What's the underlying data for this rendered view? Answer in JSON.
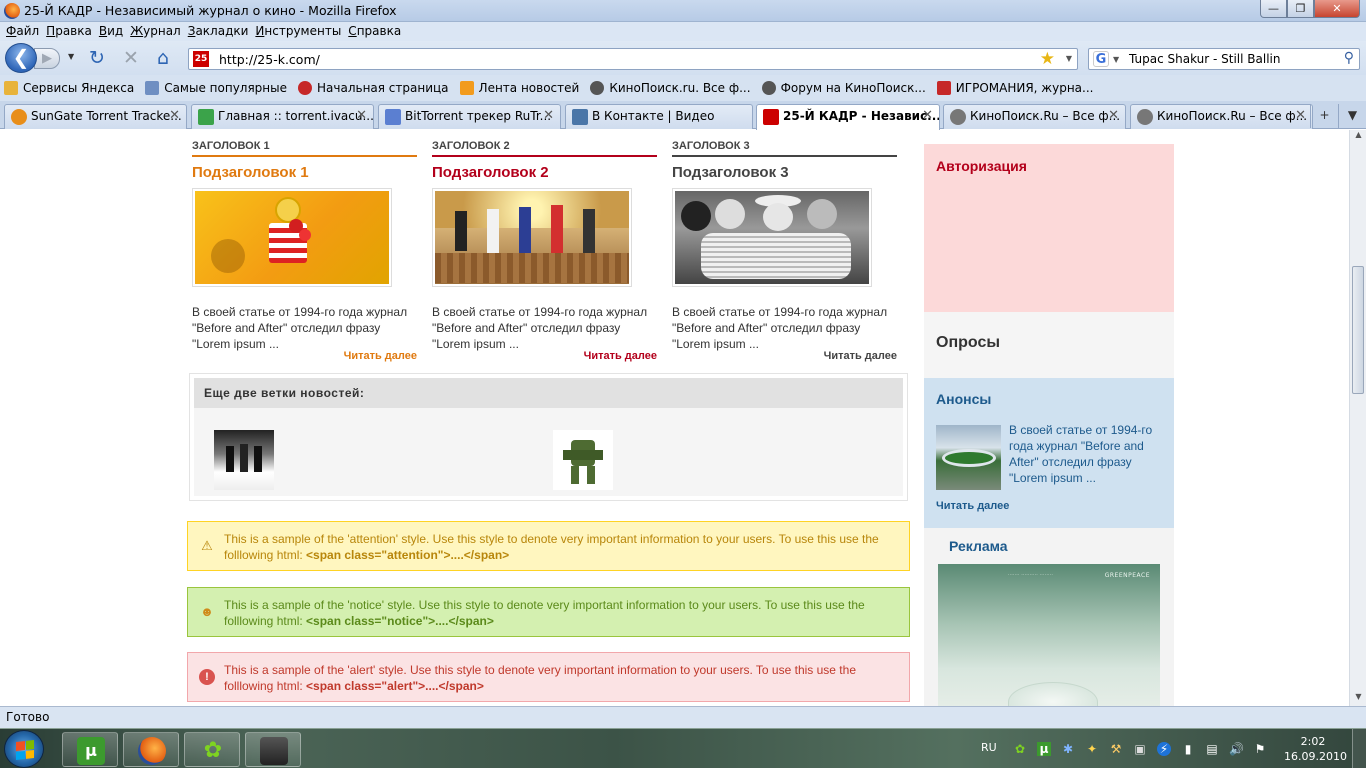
{
  "window": {
    "title": "25-Й КАДР - Независимый журнал о кино - Mozilla Firefox"
  },
  "menu": [
    "Файл",
    "Правка",
    "Вид",
    "Журнал",
    "Закладки",
    "Инструменты",
    "Справка"
  ],
  "nav": {
    "url": "http://25-k.com/",
    "site_favicon": "25",
    "search_query": "Tupac Shakur  - Still Ballin"
  },
  "bookmarks": [
    {
      "label": "Сервисы Яндекса",
      "icon": "folder-icon",
      "color": "#e8b33a"
    },
    {
      "label": "Самые популярные",
      "icon": "search-page-icon",
      "color": "#6f8fc2"
    },
    {
      "label": "Начальная страница",
      "icon": "firefox-red-icon",
      "color": "#c62828"
    },
    {
      "label": "Лента новостей",
      "icon": "rss-icon",
      "color": "#f29b1d"
    },
    {
      "label": "КиноПоиск.ru. Все ф...",
      "icon": "film-reel-icon",
      "color": "#555555"
    },
    {
      "label": "Форум на КиноПоиск...",
      "icon": "film-reel-icon",
      "color": "#555555"
    },
    {
      "label": "ИГРОМАНИЯ, журна...",
      "icon": "igromania-icon",
      "color": "#c62828"
    }
  ],
  "tabs": [
    {
      "label": "SunGate Torrent Tracke...",
      "icon_color": "#e88e1a",
      "active": false
    },
    {
      "label": "Главная :: torrent.ivacu...",
      "icon_color": "#3ba34a",
      "active": false
    },
    {
      "label": "BitTorrent трекер RuTr...",
      "icon_color": "#5b7fd1",
      "active": false
    },
    {
      "label": "В Контакте | Видео",
      "icon_color": "#4a76a8",
      "active": false
    },
    {
      "label": "25-Й КАДР - Независ...",
      "icon_color": "#cc0000",
      "active": true
    },
    {
      "label": "КиноПоиск.Ru – Все ф...",
      "icon_color": "#777777",
      "active": false
    },
    {
      "label": "КиноПоиск.Ru – Все ф...",
      "icon_color": "#777777",
      "active": false
    }
  ],
  "page": {
    "columns": [
      {
        "head": "ЗАГОЛОВОК 1",
        "sub": "Подзаголовок 1",
        "color": "#e07a10",
        "text": "В своей статье от 1994-го года журнал \"Before and After\" отследил фразу \"Lorem ipsum ...",
        "more": "Читать далее"
      },
      {
        "head": "ЗАГОЛОВОК 2",
        "sub": "Подзаголовок 2",
        "color": "#b3001b",
        "text": "В своей статье от 1994-го года журнал \"Before and After\" отследил фразу \"Lorem ipsum ...",
        "more": "Читать далее"
      },
      {
        "head": "ЗАГОЛОВОК 3",
        "sub": "Подзаголовок 3",
        "color": "#444444",
        "text": "В своей статье от 1994-го года журнал \"Before and After\" отследил фразу \"Lorem ipsum ...",
        "more": "Читать далее"
      }
    ],
    "branches_title": "Еще две ветки новостей:",
    "messages": {
      "attention": {
        "text": "This is a sample of the 'attention' style. Use this style to denote very important information to your users. To use this use the folllowing html: ",
        "code": "<span class=\"attention\">....</span>"
      },
      "notice": {
        "text": "This is a sample of the 'notice' style. Use this style to denote very important information to your users. To use this use the folllowing html: ",
        "code": "<span class=\"notice\">....</span>"
      },
      "alert": {
        "text": "This is a sample of the 'alert' style. Use this style to denote very important information to your users. To use this use the folllowing html: ",
        "code": "<span class=\"alert\">....</span>"
      }
    },
    "sidebar": {
      "auth": "Авторизация",
      "polls": "Опросы",
      "announcements": "Анонсы",
      "announcement_text": "В своей статье от 1994-го года журнал \"Before and After\" отследил фразу \"Lorem ipsum ...",
      "announcement_more": "Читать далее",
      "ads": "Реклама"
    }
  },
  "status": "Готово",
  "taskbar": {
    "lang": "RU",
    "time": "2:02",
    "date": "16.09.2010"
  }
}
